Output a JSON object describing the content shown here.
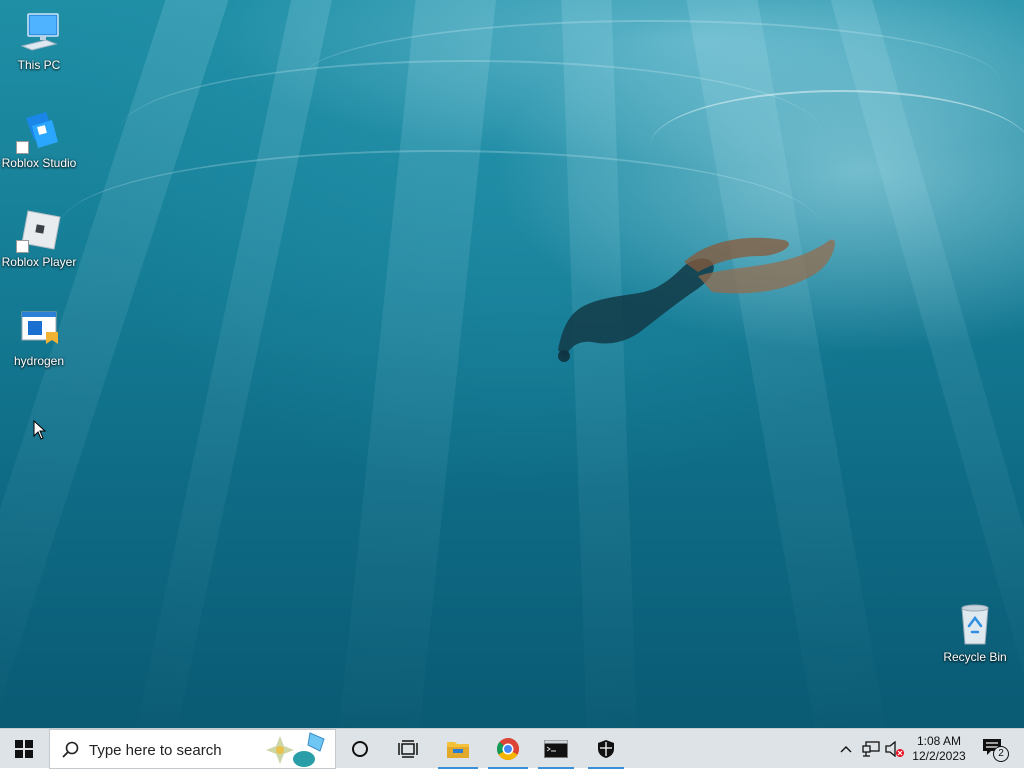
{
  "desktop": {
    "icons": [
      {
        "label": "This PC",
        "icon": "computer-icon"
      },
      {
        "label": "Roblox Studio",
        "icon": "roblox-studio-icon"
      },
      {
        "label": "Roblox Player",
        "icon": "roblox-player-icon"
      },
      {
        "label": "hydrogen",
        "icon": "app-window-icon"
      },
      {
        "label": "Recycle Bin",
        "icon": "recycle-bin-icon"
      }
    ]
  },
  "taskbar": {
    "start_icon": "windows-logo-icon",
    "search": {
      "placeholder": "Type here to search",
      "icon": "search-icon"
    },
    "apps": [
      {
        "icon": "cortana-circle-icon",
        "active": false
      },
      {
        "icon": "task-view-icon",
        "active": false
      },
      {
        "icon": "file-explorer-icon",
        "active": true
      },
      {
        "icon": "chrome-icon",
        "active": true
      },
      {
        "icon": "terminal-icon",
        "active": true
      },
      {
        "icon": "shield-icon",
        "active": true
      }
    ],
    "tray": {
      "time": "1:08 AM",
      "date": "12/2/2023",
      "notification_count": "2",
      "icons": [
        "chevron-up-icon",
        "network-icon",
        "volume-muted-icon"
      ]
    }
  },
  "colors": {
    "taskbar_bg": "#dde3e7",
    "active_indicator": "#3b8fd6",
    "desktop_water": "#167e97"
  }
}
